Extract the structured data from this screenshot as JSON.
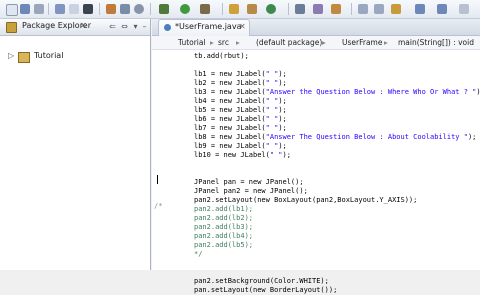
{
  "left_panel": {
    "title": "Package Explorer",
    "close": "✕",
    "tree": [
      {
        "label": "Tutorial",
        "arrow": "▷"
      }
    ]
  },
  "editor": {
    "tab": {
      "title": "*UserFrame.java",
      "close": "✕"
    },
    "breadcrumb": [
      "Tutorial",
      "src",
      "(default package)",
      "UserFrame",
      "main(String[]) : void"
    ],
    "fold_marker": "/*",
    "code_lines": [
      {
        "text": "tb.add(rbut);",
        "kind": "txt"
      },
      {
        "text": "",
        "kind": "txt"
      },
      {
        "text": "lb1 = new JLabel(\" \");",
        "kind": "txt"
      },
      {
        "text": "lb2 = new JLabel(\" \");",
        "kind": "txt"
      },
      {
        "text": "lb3 = new JLabel(\"Answer the Question Below : Where Who Or What ? \");",
        "kind": "txt"
      },
      {
        "text": "lb4 = new JLabel(\" \");",
        "kind": "txt"
      },
      {
        "text": "lb5 = new JLabel(\" \");",
        "kind": "txt"
      },
      {
        "text": "lb6 = new JLabel(\" \");",
        "kind": "txt"
      },
      {
        "text": "lb7 = new JLabel(\" \");",
        "kind": "txt"
      },
      {
        "text": "lb8 = new JLabel(\"Answer The Question Below : About Coolability \");",
        "kind": "txt"
      },
      {
        "text": "lb9 = new JLabel(\" \");",
        "kind": "txt"
      },
      {
        "text": "lb10 = new JLabel(\" \");",
        "kind": "txt"
      },
      {
        "text": "",
        "kind": "txt"
      },
      {
        "text": "",
        "kind": "txt"
      },
      {
        "text": "JPanel pan = new JPanel();",
        "kind": "txt"
      },
      {
        "text": "JPanel pan2 = new JPanel();",
        "kind": "txt"
      },
      {
        "text": "pan2.setLayout(new BoxLayout(pan2,BoxLayout.Y_AXIS));",
        "kind": "txt"
      },
      {
        "text": "pan2.add(lb1);",
        "kind": "cmt"
      },
      {
        "text": "pan2.add(lb2);",
        "kind": "cmt"
      },
      {
        "text": "pan2.add(lb3);",
        "kind": "cmt"
      },
      {
        "text": "pan2.add(lb4);",
        "kind": "cmt"
      },
      {
        "text": "pan2.add(lb5);",
        "kind": "cmt"
      },
      {
        "text": "*/",
        "kind": "cmt"
      },
      {
        "text": "",
        "kind": "txt"
      },
      {
        "text": "",
        "kind": "txt"
      },
      {
        "text": "pan2.setBackground(Color.WHITE);",
        "kind": "txt"
      },
      {
        "text": "pan.setLayout(new BorderLayout());",
        "kind": "txt"
      }
    ]
  }
}
